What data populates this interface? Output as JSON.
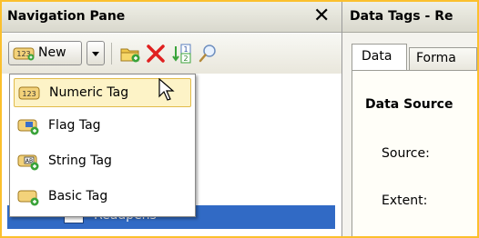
{
  "nav": {
    "title": "Navigation Pane",
    "close_glyph": "✕",
    "toolbar": {
      "new_label": "New",
      "icons": [
        "new-numeric-tag-icon",
        "dropdown-arrow-icon",
        "new-folder-icon",
        "delete-icon",
        "sort-icon",
        "find-icon"
      ]
    },
    "tree": {
      "selected_label": "Readpens"
    }
  },
  "menu": {
    "items": [
      {
        "label": "Numeric Tag",
        "icon": "numeric-tag-icon"
      },
      {
        "label": "Flag Tag",
        "icon": "flag-tag-icon"
      },
      {
        "label": "String Tag",
        "icon": "string-tag-icon"
      },
      {
        "label": "Basic Tag",
        "icon": "basic-tag-icon"
      }
    ],
    "hovered_index": 0
  },
  "data_pane": {
    "title": "Data Tags - Re",
    "tabs": [
      "Data",
      "Forma"
    ],
    "active_tab": 0,
    "section_title": "Data Source",
    "fields": {
      "source_label": "Source:",
      "extent_label": "Extent:"
    }
  },
  "colors": {
    "frame": "#fbc02d",
    "selection": "#316ac5",
    "menu_hover": "#fdf3c7",
    "delete_red": "#e02020"
  }
}
